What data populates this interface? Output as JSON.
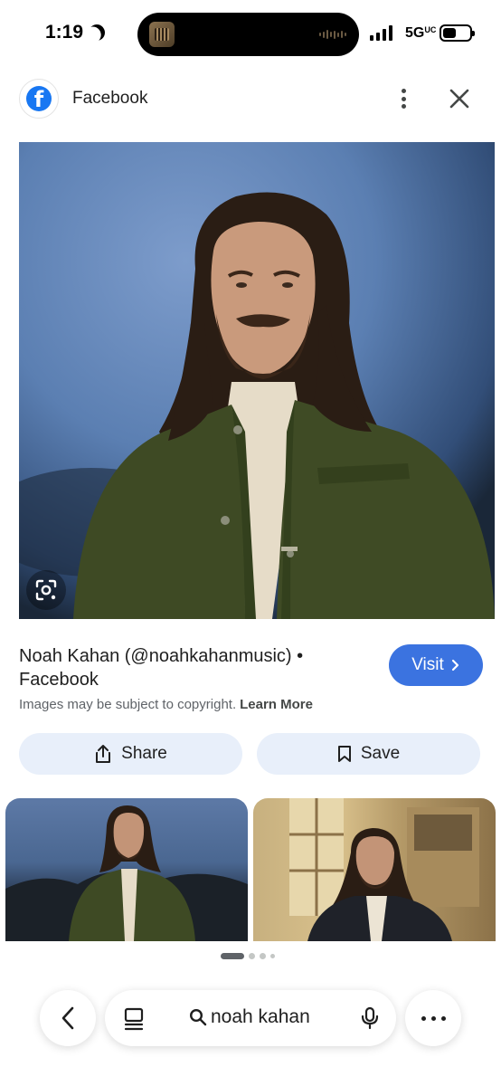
{
  "status_bar": {
    "time": "1:19",
    "network": "5G",
    "network_suffix": "UC"
  },
  "header": {
    "site_name": "Facebook"
  },
  "result": {
    "title": "Noah Kahan (@noahkahanmusic) • Facebook",
    "visit_label": "Visit",
    "copyright_notice": "Images may be subject to copyright.",
    "learn_more_label": "Learn More"
  },
  "actions": {
    "share_label": "Share",
    "save_label": "Save"
  },
  "carousel": {
    "page_count": 4,
    "active_page": 1
  },
  "bottom_bar": {
    "search_query": "noah kahan"
  },
  "colors": {
    "accent": "#3b73e0",
    "facebook_blue": "#1877f2",
    "action_bg": "#e8effa"
  }
}
